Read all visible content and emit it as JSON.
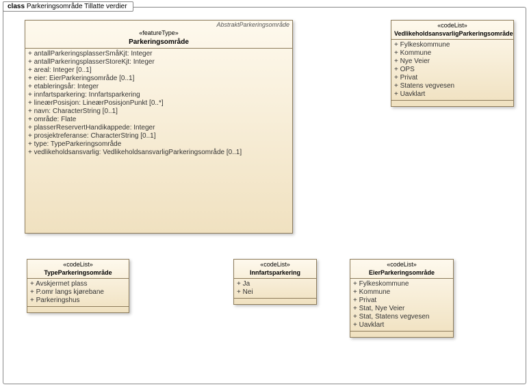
{
  "frame": {
    "kind": "class",
    "name": "Parkeringsområde Tillatte verdier"
  },
  "classes": [
    {
      "parent": "AbstraktParkeringsområde",
      "stereo": "«featureType»",
      "name": "Parkeringsområde",
      "attrs": [
        "antallParkeringsplasserSmåKjt: Integer",
        "antallParkeringsplasserStoreKjt: Integer",
        "areal: Integer [0..1]",
        "eier: EierParkeringsområde [0..1]",
        "etableringsår: Integer",
        "innfartsparkering: Innfartsparkering",
        "lineærPosisjon: LineærPosisjonPunkt [0..*]",
        "navn: CharacterString [0..1]",
        "område: Flate",
        "plasserReservertHandikappede: Integer",
        "prosjektreferanse: CharacterString [0..1]",
        "type: TypeParkeringsområde",
        "vedlikeholdsansvarlig: VedlikeholdsansvarligParkeringsområde [0..1]"
      ]
    },
    {
      "stereo": "«codeList»",
      "name": "VedlikeholdsansvarligParkeringsområde",
      "attrs": [
        "Fylkeskommune",
        "Kommune",
        "Nye Veier",
        "OPS",
        "Privat",
        "Statens vegvesen",
        "Uavklart"
      ]
    },
    {
      "stereo": "«codeList»",
      "name": "TypeParkeringsområde",
      "attrs": [
        "Avskjermet plass",
        "P.omr langs kjørebane",
        "Parkeringshus"
      ]
    },
    {
      "stereo": "«codeList»",
      "name": "Innfartsparkering",
      "attrs": [
        "Ja",
        "Nei"
      ]
    },
    {
      "stereo": "«codeList»",
      "name": "EierParkeringsområde",
      "attrs": [
        "Fylkeskommune",
        "Kommune",
        "Privat",
        "Stat, Nye Veier",
        "Stat, Statens vegvesen",
        "Uavklart"
      ]
    }
  ]
}
